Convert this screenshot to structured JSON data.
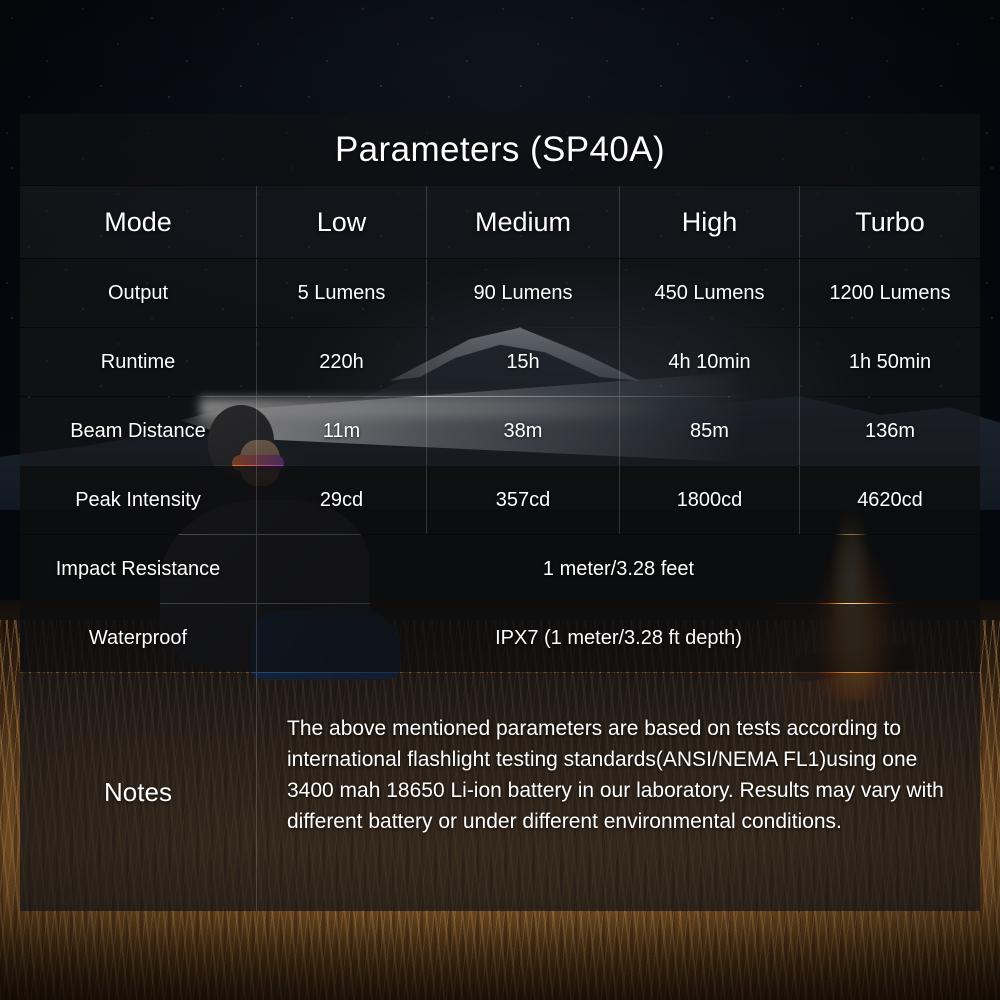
{
  "table": {
    "title": "Parameters (SP40A)",
    "header": {
      "label": "Mode",
      "modes": [
        "Low",
        "Medium",
        "High",
        "Turbo"
      ]
    },
    "rows": [
      {
        "label": "Output",
        "values": [
          "5 Lumens",
          "90 Lumens",
          "450 Lumens",
          "1200 Lumens"
        ]
      },
      {
        "label": "Runtime",
        "values": [
          "220h",
          "15h",
          "4h 10min",
          "1h 50min"
        ]
      },
      {
        "label": "Beam Distance",
        "values": [
          "11m",
          "38m",
          "85m",
          "136m"
        ]
      },
      {
        "label": "Peak Intensity",
        "values": [
          "29cd",
          "357cd",
          "1800cd",
          "4620cd"
        ]
      }
    ],
    "merged_rows": [
      {
        "label": "Impact Resistance",
        "value": "1 meter/3.28 feet"
      },
      {
        "label": "Waterproof",
        "value": "IPX7 (1 meter/3.28 ft depth)"
      }
    ],
    "notes": {
      "label": "Notes",
      "text": "The above mentioned parameters are based on tests according to international flashlight testing standards(ANSI/NEMA FL1)using one 3400 mah 18650 Li-ion battery in our laboratory. Results may vary with different battery or under different environmental conditions."
    }
  },
  "colors": {
    "text": "#ffffff",
    "cell_bg": "rgba(22,22,24,0.62)",
    "cell_bg_dark": "rgba(14,14,15,0.88)",
    "divider": "rgba(255,255,255,0.16)"
  }
}
